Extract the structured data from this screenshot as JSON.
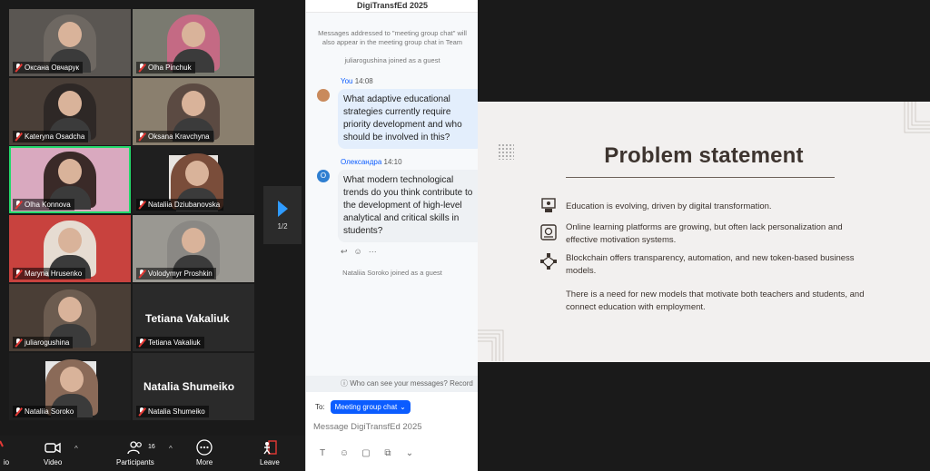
{
  "participants": [
    {
      "name": "Оксана Овчарук",
      "muted": true
    },
    {
      "name": "Olha Pinchuk",
      "muted": true
    },
    {
      "name": "Kateryna Osadcha",
      "muted": true
    },
    {
      "name": "Oksana Kravchyna",
      "muted": true
    },
    {
      "name": "Olha Konnova",
      "muted": true,
      "active": true
    },
    {
      "name": "Nataliia Dziubanovska",
      "muted": true
    },
    {
      "name": "Maryna Hrusenko",
      "muted": true
    },
    {
      "name": "Volodymyr Proshkin",
      "muted": true
    },
    {
      "name": "juliarogushina",
      "muted": true
    },
    {
      "name": "Tetiana Vakaliuk",
      "muted": true,
      "display_name": "Tetiana Vakaliuk"
    },
    {
      "name": "Nataliia Soroko",
      "muted": true
    },
    {
      "name": "Natalia Shumeiko",
      "muted": true,
      "display_name": "Natalia Shumeiko"
    }
  ],
  "page_indicator": "1/2",
  "toolbar": {
    "audio_label": "io",
    "video_label": "Video",
    "participants_label": "Participants",
    "participants_count": "16",
    "more_label": "More",
    "leave_label": "Leave"
  },
  "chat": {
    "title": "DigiTransfEd 2025",
    "notice_line1": "Messages addressed to \"meeting group chat\" will",
    "notice_line2": "also appear in the meeting group chat in Team",
    "join1": "juliarogushina joined as a guest",
    "msg1_sender": "You",
    "msg1_time": "14:08",
    "msg1_text": "What adaptive educational strategies currently require priority development and who should be involved in this?",
    "msg2_sender": "Олександра",
    "msg2_time": "14:10",
    "msg2_initial": "O",
    "msg2_text": "What modern technological trends do you think contribute to the development of high-level analytical and critical skills in students?",
    "join2": "Nataliia Soroko joined as a guest",
    "who_can_see": "Who can see your messages? Record",
    "to_label": "To:",
    "to_target": "Meeting group chat",
    "input_placeholder": "Message DigiTransfEd 2025",
    "colors": {
      "accent": "#0b5cff",
      "bubble_self": "#e3eefc"
    }
  },
  "slide": {
    "title": "Problem statement",
    "bullets": [
      "Education is evolving, driven by digital transformation.",
      "Online learning platforms are growing, but often lack personalization and effective motivation systems.",
      "Blockchain offers transparency, automation, and new token-based business models.",
      "There is a need for new models that motivate both teachers and students, and connect education with employment."
    ],
    "colors": {
      "background": "#f2f0ef",
      "text": "#3d342f"
    }
  }
}
